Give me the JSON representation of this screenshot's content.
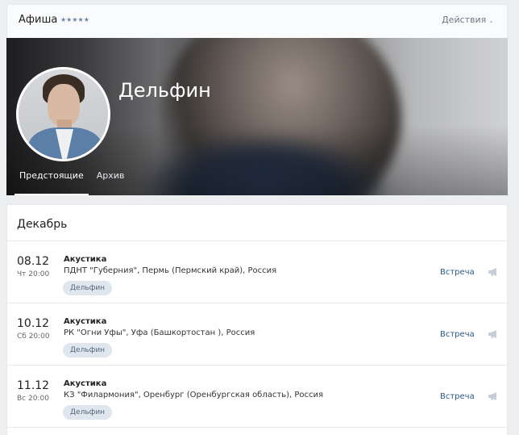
{
  "header": {
    "title": "Афиша",
    "rating_stars": "★★★★★",
    "actions_label": "Действия",
    "actions_chevron": "⌄"
  },
  "artist": {
    "name": "Дельфин"
  },
  "tabs": [
    {
      "label": "Предстоящие",
      "active": true
    },
    {
      "label": "Архив",
      "active": false
    }
  ],
  "month": "Декабрь",
  "events": [
    {
      "date": "08.12",
      "time": "Чт 20:00",
      "title": "Акустика",
      "venue": "ПДНТ \"Губерния\", Пермь (Пермский край), Россия",
      "tag": "Дельфин",
      "action": "Встреча"
    },
    {
      "date": "10.12",
      "time": "Сб 20:00",
      "title": "Акустика",
      "venue": "РК \"Огни Уфы\", Уфа (Башкортостан ), Россия",
      "tag": "Дельфин",
      "action": "Встреча"
    },
    {
      "date": "11.12",
      "time": "Вс 20:00",
      "title": "Акустика",
      "venue": "КЗ \"Филармония\", Оренбург (Оренбургская область), Россия",
      "tag": "Дельфин",
      "action": "Встреча"
    }
  ],
  "colors": {
    "accent_link": "#2a5885",
    "tag_bg": "#dfe6ee",
    "page_bg": "#edeef0"
  },
  "icons": {
    "announce": "bullhorn-icon"
  }
}
